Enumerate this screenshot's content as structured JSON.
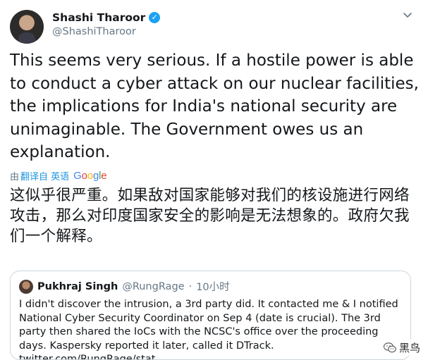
{
  "author": {
    "name": "Shashi Tharoor",
    "handle": "@ShashiTharoor",
    "verified_icon": "verified-badge-icon"
  },
  "tweet": {
    "text": "This seems very serious. If a hostile power is able to conduct a cyber attack on our nuclear facilities, the implications for India's national security are unimaginable. The Government owes us an explanation."
  },
  "translation": {
    "prefix": "由",
    "link": "翻译自 英语",
    "provider": "Google",
    "text": "这似乎很严重。如果敌对国家能够对我们的核设施进行网络攻击，那么对印度国家安全的影响是无法想象的。政府欠我们一个解释。"
  },
  "quote": {
    "name": "Pukhraj Singh",
    "handle": "@RungRage",
    "separator": "·",
    "time": "10小时",
    "text": "I didn't discover the intrusion, a 3rd party did. It contacted me & I notified National Cyber Security Coordinator on Sep 4 (date is crucial). The 3rd party then shared the IoCs with the NCSC's office over the proceeding days. Kaspersky reported it later, called it DTrack. twitter.com/RungRage/stat…"
  },
  "watermark": {
    "text": "黑鸟"
  },
  "colors": {
    "accent": "#1da1f2",
    "link": "#1b95e0",
    "secondary_text": "#657786",
    "border": "#ccd6dd"
  }
}
